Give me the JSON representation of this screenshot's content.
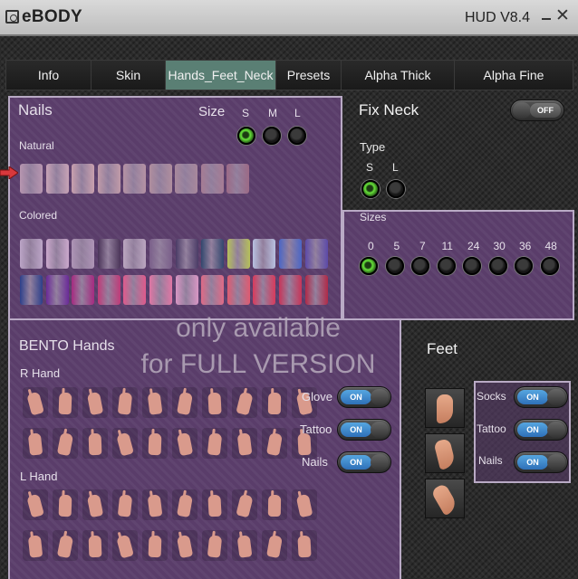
{
  "window": {
    "app_title": "eBODY",
    "version": "HUD V8.4"
  },
  "tabs": [
    "Info",
    "Skin",
    "Hands_Feet_Neck",
    "Presets",
    "Alpha Thick",
    "Alpha Fine"
  ],
  "active_tab": "Hands_Feet_Neck",
  "nails": {
    "title": "Nails",
    "size_label": "Size",
    "sizes": [
      "S",
      "M",
      "L"
    ],
    "selected_size": "S",
    "natural_label": "Natural",
    "colored_label": "Colored",
    "natural_colors": [
      "#b896b0",
      "#c8a3b6",
      "#c9a0ae",
      "#c09aa8",
      "#b592a4",
      "#b08e9e",
      "#a8889c",
      "#a67c94",
      "#9c6a86"
    ],
    "colored_row1": [
      "#bca5c7",
      "#caa8cc",
      "#ae94b6",
      "#4a3458",
      "#bba6c0",
      "#7a5f8a",
      "#4a3b66",
      "#32476e",
      "#b6c05a",
      "#b8c0e0",
      "#4a66c6",
      "#5c4aa8"
    ],
    "colored_row2": [
      "#2c3f8a",
      "#6a2a98",
      "#a62a80",
      "#c03a78",
      "#e05a8c",
      "#e076a4",
      "#d896c4",
      "#e06a86",
      "#e05a70",
      "#d83a5c",
      "#c83458",
      "#b02a48"
    ]
  },
  "fix_neck": {
    "title": "Fix Neck",
    "toggle": "OFF",
    "type_label": "Type",
    "types": [
      "S",
      "L"
    ],
    "selected_type": "S",
    "sizes_label": "Sizes",
    "sizes": [
      "0",
      "5",
      "7",
      "11",
      "24",
      "30",
      "36",
      "48"
    ],
    "selected_size": "0"
  },
  "bento": {
    "title": "BENTO Hands",
    "r_hand_label": "R Hand",
    "l_hand_label": "L Hand",
    "glove_label": "Glove",
    "tattoo_label": "Tattoo",
    "nails_label": "Nails",
    "glove_toggle": "ON",
    "tattoo_toggle": "ON",
    "nails_toggle": "ON"
  },
  "watermark": {
    "line1": "only available",
    "line2": "for FULL VERSION"
  },
  "feet": {
    "title": "Feet",
    "socks_label": "Socks",
    "tattoo_label": "Tattoo",
    "nails_label": "Nails",
    "socks_toggle": "ON",
    "tattoo_toggle": "ON",
    "nails_toggle": "ON"
  }
}
